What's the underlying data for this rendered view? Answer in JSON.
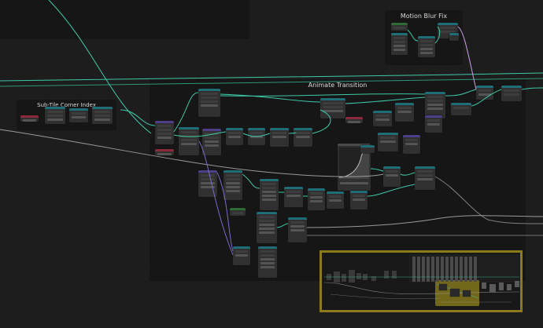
{
  "frames": {
    "motion_blur": {
      "label": "Motion Blur Fix"
    },
    "sub_tile": {
      "label": "Sub-Tile Corner Index"
    },
    "animate_transition": {
      "label": "Animate Transition"
    }
  },
  "colors": {
    "background": "#1d1d1d",
    "frame": "#161616",
    "node_body": "#303030",
    "header_teal": "#1f6d76",
    "header_green": "#2f6b35",
    "header_purple": "#4c3f88",
    "header_red": "#8b2a3d",
    "link_teal": "#3ec9a6",
    "link_gray": "#9a9a9a",
    "link_purple": "#7a6ac8",
    "highlight_border": "#8c7a1f",
    "highlight_fill": "#bfa820"
  },
  "icons": {
    "corner": "editor-type-icon"
  }
}
